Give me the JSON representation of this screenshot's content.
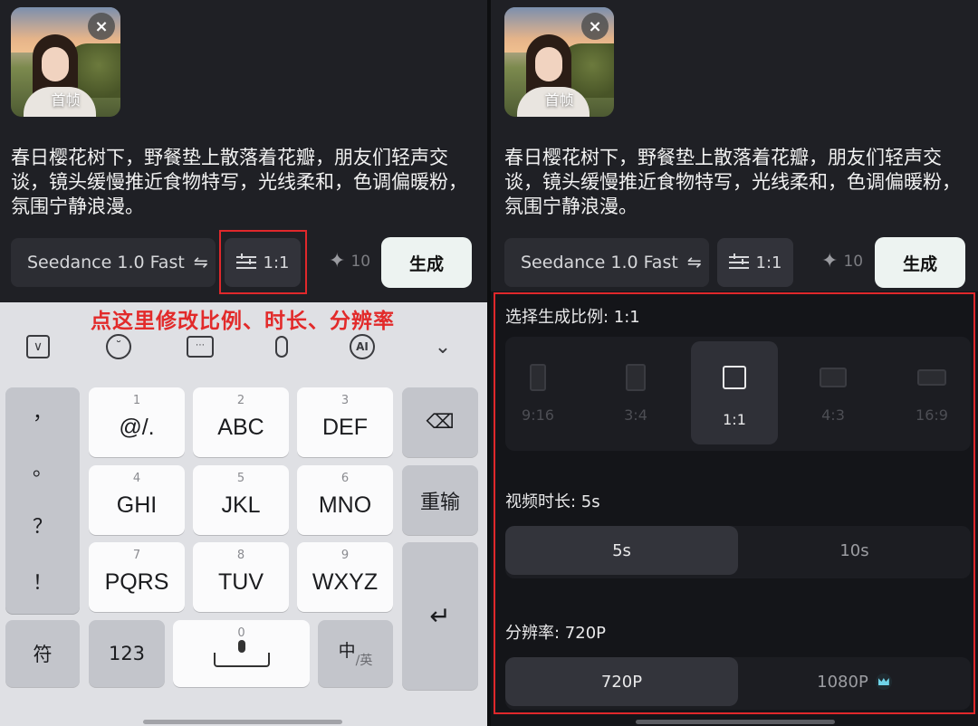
{
  "left": {
    "thumbnail_caption": "首帧",
    "prompt": "春日樱花树下，野餐垫上散落着花瓣，朋友们轻声交谈，镜头缓慢推近食物特写，光线柔和，色调偏暖粉，氛围宁静浪漫。",
    "model_label": "Seedance 1.0 Fast",
    "model_swap_icon": "⇋",
    "ratio_label": "1:1",
    "credits": "10",
    "generate_label": "生成",
    "annotation": "点这里修改比例、时长、分辨率",
    "keyboard": {
      "toolbar_icons": [
        "collapse-icon",
        "emoji-icon",
        "keyboard-icon",
        "mic-icon",
        "ai-icon",
        "chevron-down-icon"
      ],
      "punctuation": [
        "，",
        "。",
        "？",
        "！"
      ],
      "keys": [
        {
          "num": "1",
          "label": "@/."
        },
        {
          "num": "2",
          "label": "ABC"
        },
        {
          "num": "3",
          "label": "DEF"
        },
        {
          "num": "4",
          "label": "GHI"
        },
        {
          "num": "5",
          "label": "JKL"
        },
        {
          "num": "6",
          "label": "MNO"
        },
        {
          "num": "7",
          "label": "PQRS"
        },
        {
          "num": "8",
          "label": "TUV"
        },
        {
          "num": "9",
          "label": "WXYZ"
        }
      ],
      "retype_label": "重输",
      "symbol_label": "符",
      "numeric_label": "123",
      "space_num": "0",
      "lang_main": "中",
      "lang_sub": "/英"
    }
  },
  "right": {
    "thumbnail_caption": "首帧",
    "prompt": "春日樱花树下，野餐垫上散落着花瓣，朋友们轻声交谈，镜头缓慢推近食物特写，光线柔和，色调偏暖粉，氛围宁静浪漫。",
    "model_label": "Seedance 1.0 Fast",
    "model_swap_icon": "⇋",
    "ratio_label": "1:1",
    "credits": "10",
    "generate_label": "生成",
    "ratio_title": "选择生成比例: 1:1",
    "ratios": [
      "9:16",
      "3:4",
      "1:1",
      "4:3",
      "16:9"
    ],
    "selected_ratio": "1:1",
    "duration_title": "视频时长: 5s",
    "durations": [
      "5s",
      "10s"
    ],
    "selected_duration": "5s",
    "resolution_title": "分辨率: 720P",
    "resolutions": [
      "720P",
      "1080P"
    ],
    "selected_resolution": "720P"
  },
  "colors": {
    "annotation_red": "#e22a2a",
    "panel_bg": "#1f2025",
    "generate_bg": "#edf3f1"
  }
}
